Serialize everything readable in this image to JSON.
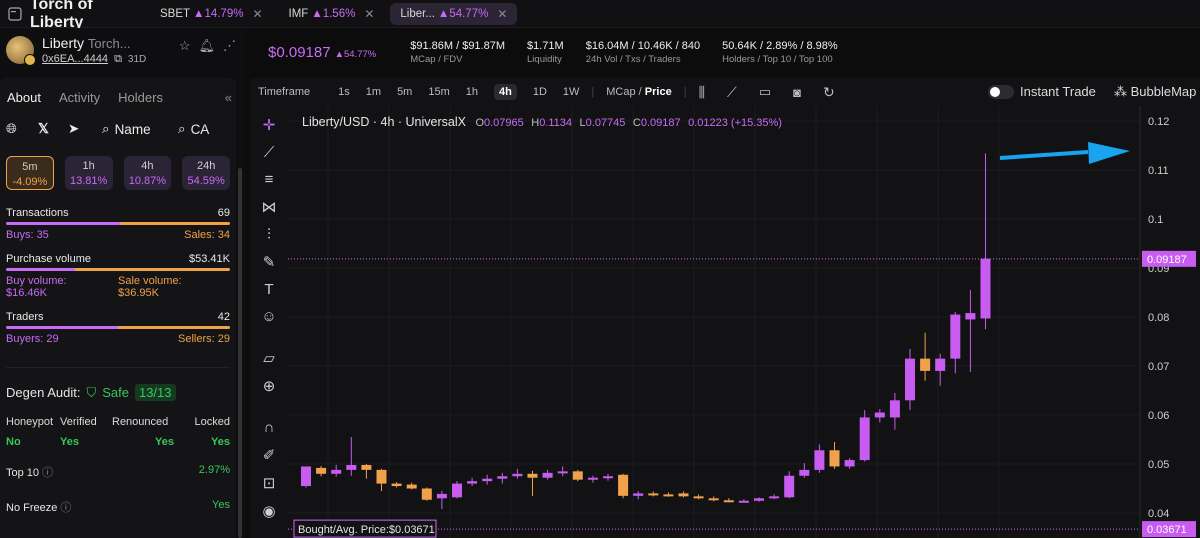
{
  "topbar": {
    "brand": "Torch of Liberty",
    "chips": [
      {
        "name": "SBET",
        "pct": "14.79%"
      },
      {
        "name": "IMF",
        "pct": "1.56%"
      },
      {
        "name": "Liber...",
        "pct": "54.77%"
      }
    ]
  },
  "token": {
    "name": "Liberty",
    "fullname": "Torch...",
    "address": "0x6EA...4444",
    "age": "31D"
  },
  "tabs": [
    "About",
    "Activity",
    "Holders"
  ],
  "social": {
    "name_btn": "Name",
    "ca_btn": "CA"
  },
  "timeframes": [
    {
      "label": "5m",
      "value": "-4.09%"
    },
    {
      "label": "1h",
      "value": "13.81%"
    },
    {
      "label": "4h",
      "value": "10.87%"
    },
    {
      "label": "24h",
      "value": "54.59%"
    }
  ],
  "stats": {
    "transactions_label": "Transactions",
    "transactions": "69",
    "buys": "Buys: 35",
    "sales": "Sales: 34",
    "pv_label": "Purchase volume",
    "pv": "$53.41K",
    "buy_volume_label": "Buy volume:",
    "buy_volume": "$16.46K",
    "sale_volume_label": "Sale volume:",
    "sale_volume": "$36.95K",
    "traders_label": "Traders",
    "traders": "42",
    "buyers": "Buyers: 29",
    "sellers": "Sellers: 29",
    "buys_fraction": 0.507,
    "pv_fraction": 0.31,
    "traders_fraction": 0.5
  },
  "audit": {
    "title": "Degen Audit:",
    "safe": "Safe",
    "score": "13/13",
    "headers": [
      "Honeypot",
      "Verified",
      "Renounced",
      "Locked"
    ],
    "values": [
      "No",
      "Yes",
      "Yes",
      "Yes"
    ],
    "top10_label": "Top 10",
    "top10": "2.97%",
    "nofreeze_label": "No Freeze",
    "nofreeze": "Yes"
  },
  "summary": {
    "price": "$0.09187",
    "price_pct": "54.77%",
    "metrics": [
      {
        "value": "$91.86M / $91.87M",
        "label": "MCap / FDV"
      },
      {
        "value": "$1.71M",
        "label": "Liquidity"
      },
      {
        "value": "$16.04M / 10.46K / 840",
        "label": "24h Vol / Txs / Traders"
      },
      {
        "value": "50.64K / 2.89% / 8.98%",
        "label": "Holders / Top 10 / Top 100"
      }
    ]
  },
  "toolbar": {
    "timeframe_label": "Timeframe",
    "intervals": [
      "1s",
      "1m",
      "5m",
      "15m",
      "1h",
      "4h",
      "1D",
      "1W"
    ],
    "active_interval": "4h",
    "mcap": "MCap",
    "price": "Price",
    "instant_trade": "Instant Trade",
    "bubblemap": "BubbleMap"
  },
  "chart_data": {
    "type": "candlestick",
    "legend": {
      "symbol": "Liberty/USD · 4h · UniversalX",
      "O": "0.07965",
      "H": "0.1134",
      "L": "0.07745",
      "C": "0.09187",
      "change": "0.01223 (+15.35%)"
    },
    "y_ticks": [
      0.12,
      0.11,
      0.1,
      0.09,
      0.08,
      0.07,
      0.06,
      0.05,
      0.04
    ],
    "y_tick_labels": [
      "0.12",
      "0.11",
      "0.1",
      "0.09",
      "0.08",
      "0.07",
      "0.06",
      "0.05",
      "0.04"
    ],
    "ylim": [
      0.036,
      0.12
    ],
    "current_price": 0.09187,
    "current_price_label": "0.09187",
    "avg_price": 0.03671,
    "avg_price_label": "0.03671",
    "bought_label": "Bought/Avg. Price:$0.03671",
    "candles": [
      [
        0.0455,
        0.0495,
        0.0452,
        0.0495
      ],
      [
        0.0492,
        0.0496,
        0.0475,
        0.048
      ],
      [
        0.048,
        0.0498,
        0.0474,
        0.0488
      ],
      [
        0.0488,
        0.0555,
        0.0476,
        0.0498
      ],
      [
        0.0498,
        0.05,
        0.047,
        0.0488
      ],
      [
        0.0488,
        0.049,
        0.0445,
        0.046
      ],
      [
        0.046,
        0.0463,
        0.0452,
        0.0455
      ],
      [
        0.0458,
        0.0462,
        0.0448,
        0.045
      ],
      [
        0.045,
        0.0452,
        0.0425,
        0.0427
      ],
      [
        0.043,
        0.0445,
        0.0408,
        0.0439
      ],
      [
        0.0432,
        0.0465,
        0.043,
        0.046
      ],
      [
        0.046,
        0.0472,
        0.0455,
        0.0465
      ],
      [
        0.0465,
        0.0478,
        0.0458,
        0.047
      ],
      [
        0.047,
        0.0482,
        0.046,
        0.0475
      ],
      [
        0.0475,
        0.049,
        0.047,
        0.048
      ],
      [
        0.048,
        0.0486,
        0.0435,
        0.0472
      ],
      [
        0.0472,
        0.0488,
        0.0468,
        0.0482
      ],
      [
        0.0482,
        0.0495,
        0.0475,
        0.0485
      ],
      [
        0.0485,
        0.0488,
        0.0465,
        0.0468
      ],
      [
        0.0468,
        0.0476,
        0.0462,
        0.0472
      ],
      [
        0.0472,
        0.048,
        0.0466,
        0.0475
      ],
      [
        0.0478,
        0.048,
        0.043,
        0.0435
      ],
      [
        0.0435,
        0.0445,
        0.0428,
        0.044
      ],
      [
        0.044,
        0.0444,
        0.0434,
        0.0438
      ],
      [
        0.0438,
        0.0442,
        0.0433,
        0.0436
      ],
      [
        0.044,
        0.0444,
        0.0432,
        0.0434
      ],
      [
        0.0434,
        0.0438,
        0.0428,
        0.043
      ],
      [
        0.043,
        0.0434,
        0.0424,
        0.0428
      ],
      [
        0.0426,
        0.043,
        0.0422,
        0.0424
      ],
      [
        0.0424,
        0.0428,
        0.0421,
        0.0425
      ],
      [
        0.0425,
        0.0432,
        0.0423,
        0.043
      ],
      [
        0.043,
        0.0438,
        0.0428,
        0.0434
      ],
      [
        0.0432,
        0.0485,
        0.043,
        0.0476
      ],
      [
        0.0476,
        0.0502,
        0.0472,
        0.0488
      ],
      [
        0.0488,
        0.054,
        0.0482,
        0.0528
      ],
      [
        0.0528,
        0.0545,
        0.049,
        0.0495
      ],
      [
        0.0495,
        0.0512,
        0.049,
        0.0508
      ],
      [
        0.0508,
        0.061,
        0.0505,
        0.0595
      ],
      [
        0.0595,
        0.0612,
        0.0585,
        0.0605
      ],
      [
        0.0595,
        0.0645,
        0.057,
        0.063
      ],
      [
        0.063,
        0.0735,
        0.061,
        0.0715
      ],
      [
        0.0715,
        0.0768,
        0.067,
        0.069
      ],
      [
        0.069,
        0.0725,
        0.066,
        0.0715
      ],
      [
        0.0715,
        0.081,
        0.0685,
        0.0805
      ],
      [
        0.0795,
        0.0855,
        0.0688,
        0.0808
      ],
      [
        0.0797,
        0.1134,
        0.0775,
        0.0919
      ]
    ]
  }
}
